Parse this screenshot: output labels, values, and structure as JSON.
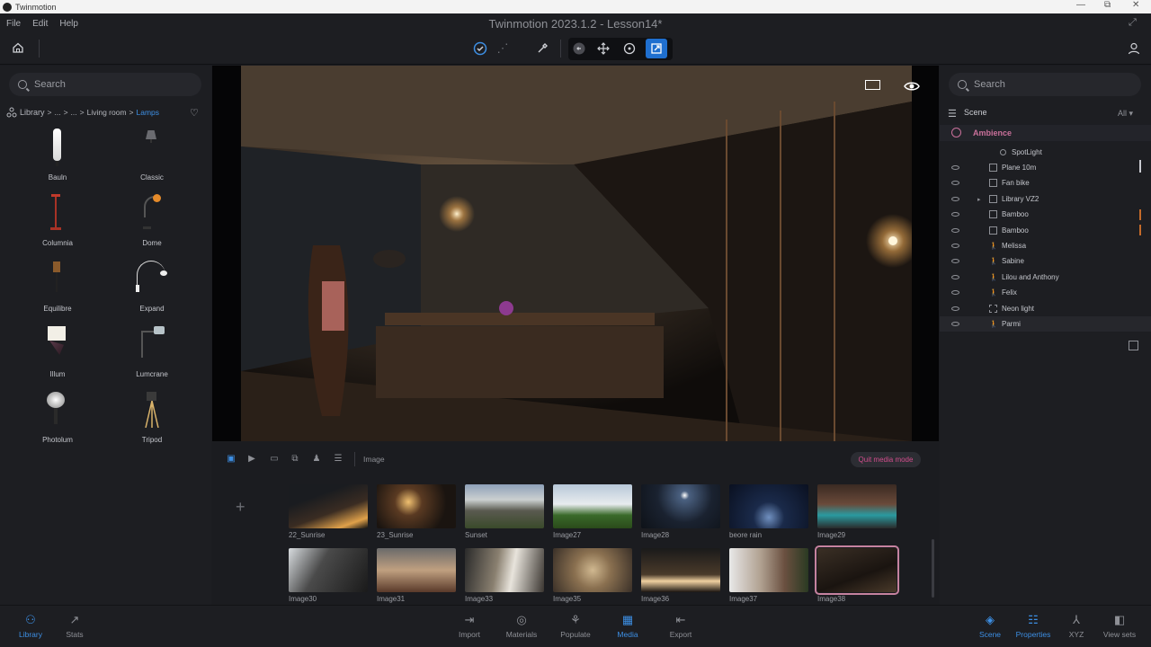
{
  "window": {
    "app_name": "Twinmotion",
    "minimize": "—",
    "restore": "⧉",
    "close": "✕"
  },
  "menu": [
    "File",
    "Edit",
    "Help"
  ],
  "app_title": "Twinmotion 2023.1.2 - Lesson14*",
  "library": {
    "search_placeholder": "Search",
    "breadcrumb": [
      "Library",
      "...",
      "...",
      "Living room",
      "Lamps"
    ],
    "items": [
      {
        "label": "Bauln",
        "icon": "floor-lamp-icon"
      },
      {
        "label": "Classic",
        "icon": "table-lamp-icon"
      },
      {
        "label": "Columnia",
        "icon": "floor-lamp-icon"
      },
      {
        "label": "Dome",
        "icon": "arc-lamp-icon"
      },
      {
        "label": "Equilibre",
        "icon": "lamp-icon"
      },
      {
        "label": "Expand",
        "icon": "arc-lamp-icon"
      },
      {
        "label": "Illum",
        "icon": "table-lamp-icon"
      },
      {
        "label": "Lumcrane",
        "icon": "crane-lamp-icon"
      },
      {
        "label": "Photolum",
        "icon": "spot-lamp-icon"
      },
      {
        "label": "Tripod",
        "icon": "tripod-lamp-icon"
      }
    ]
  },
  "media_bar": {
    "section_label": "Image",
    "quit_label": "Quit media mode",
    "add": "+"
  },
  "media": [
    [
      "22_Sunrise",
      "23_Sunrise",
      "Sunset",
      "Image27",
      "Image28",
      "beore rain",
      "Image29"
    ],
    [
      "Image30",
      "Image31",
      "Image33",
      "Image35",
      "Image36",
      "Image37",
      "Image38"
    ]
  ],
  "scene": {
    "search_placeholder": "Search",
    "title": "Scene",
    "filter": "All",
    "ambience": "Ambience",
    "rows": [
      "SpotLight",
      "Plane 10m",
      "Fan bike",
      "Library VZ2",
      "Bamboo",
      "Bamboo",
      "Melissa",
      "Sabine",
      "Lilou and Anthony",
      "Felix",
      "Neon light",
      "Parmi"
    ]
  },
  "bottom_left": [
    "Library",
    "Stats"
  ],
  "bottom_center": [
    "Import",
    "Materials",
    "Populate",
    "Media",
    "Export"
  ],
  "bottom_right": [
    "Scene",
    "Properties",
    "XYZ",
    "View sets"
  ],
  "colors": {
    "accent": "#3d8fe4",
    "media_accent": "#d24d8c",
    "ambience": "#c9709a",
    "selected_outline": "#c6829f"
  }
}
